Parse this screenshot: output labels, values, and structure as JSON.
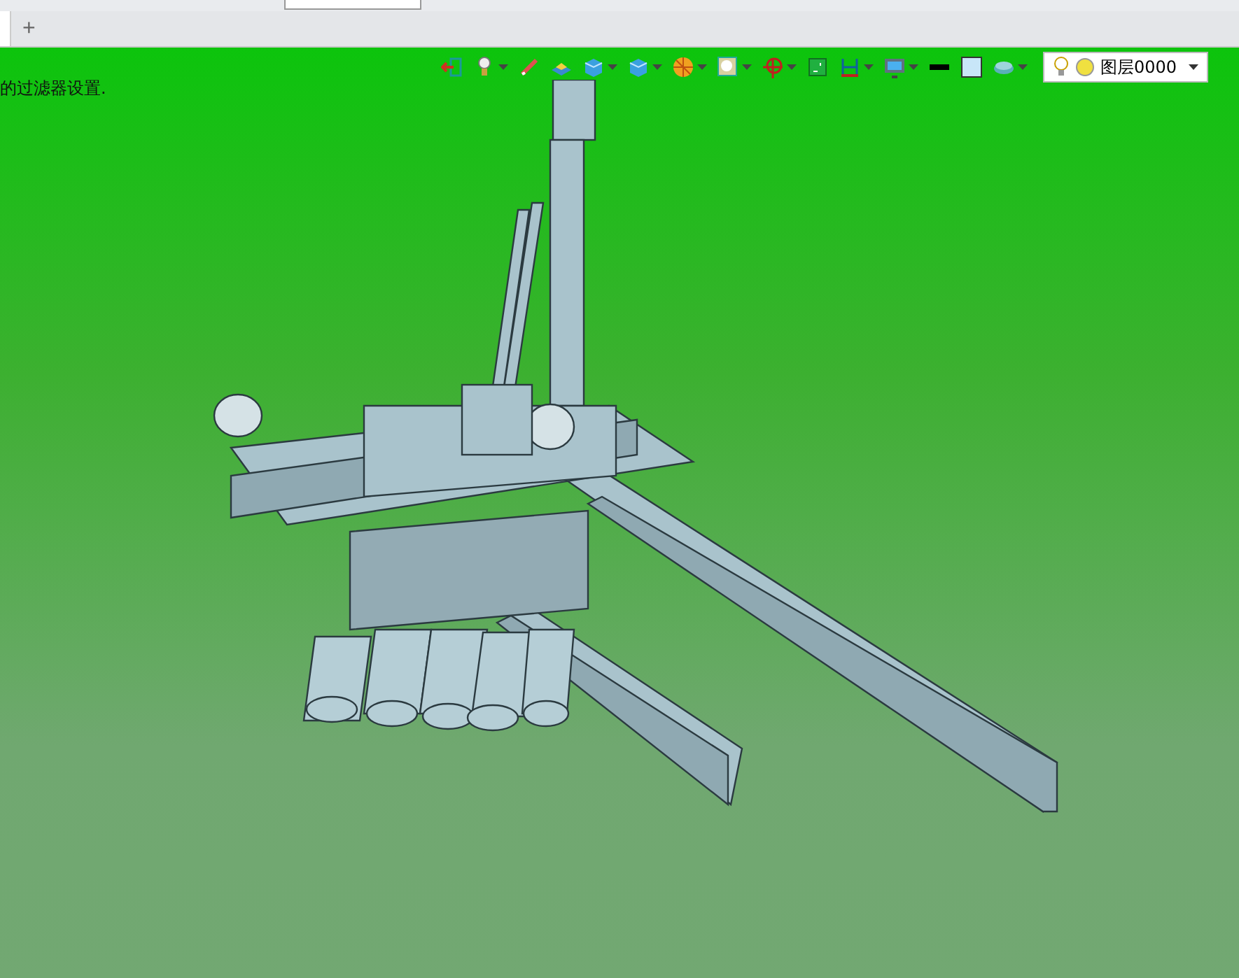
{
  "tab_bar": {
    "new_tab": "+"
  },
  "viewport": {
    "status_text": "的过滤器设置.",
    "toolbar": [
      {
        "dropdown": false
      },
      {
        "dropdown": true
      },
      {
        "dropdown": false
      },
      {
        "dropdown": false
      },
      {
        "dropdown": true
      },
      {
        "dropdown": true
      },
      {
        "dropdown": true
      },
      {
        "dropdown": true
      },
      {
        "dropdown": true
      },
      {
        "dropdown": false
      },
      {
        "dropdown": true
      },
      {
        "dropdown": true
      },
      {
        "dropdown": false
      },
      {
        "dropdown": false
      },
      {
        "dropdown": true
      }
    ],
    "layer_selector": {
      "value": "图层0000"
    }
  }
}
